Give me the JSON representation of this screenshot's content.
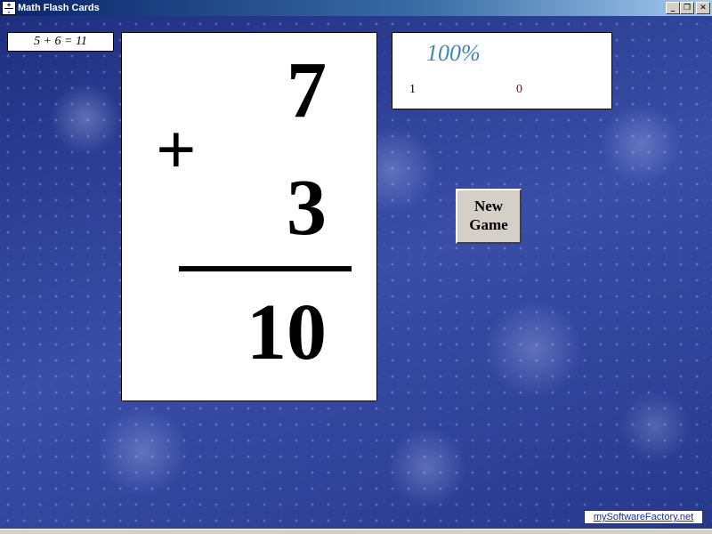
{
  "window": {
    "title": "Math Flash Cards",
    "icon": "flash-card-fraction-icon",
    "controls": {
      "minimize": "_",
      "maximize": "❐",
      "close": "✕"
    }
  },
  "last_problem": "5 + 6 = 11",
  "card": {
    "top_number": "7",
    "operator": "+",
    "bottom_number": "3",
    "answer": "10"
  },
  "score": {
    "percent": "100%",
    "right": "1",
    "wrong": "0"
  },
  "new_game_label_line1": "New",
  "new_game_label_line2": "Game",
  "footer_link": "mySoftwareFactory.net",
  "colors": {
    "title_bar_start": "#0a246a",
    "background": "#34449a",
    "percent_text": "#3d87b8",
    "wrong_text": "#a00000"
  }
}
